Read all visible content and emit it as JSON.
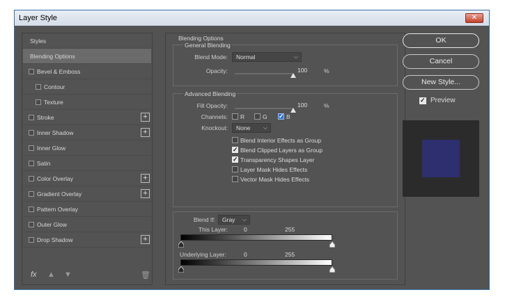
{
  "window": {
    "title": "Layer Style",
    "close_icon": "close-icon"
  },
  "styles_list": {
    "header": "Styles",
    "items": [
      {
        "label": "Blending Options",
        "checkbox": false,
        "selected": true,
        "plus": false,
        "indent": false
      },
      {
        "label": "Bevel & Emboss",
        "checkbox": true,
        "selected": false,
        "plus": false,
        "indent": false
      },
      {
        "label": "Contour",
        "checkbox": true,
        "selected": false,
        "plus": false,
        "indent": true
      },
      {
        "label": "Texture",
        "checkbox": true,
        "selected": false,
        "plus": false,
        "indent": true
      },
      {
        "label": "Stroke",
        "checkbox": true,
        "selected": false,
        "plus": true,
        "indent": false
      },
      {
        "label": "Inner Shadow",
        "checkbox": true,
        "selected": false,
        "plus": true,
        "indent": false
      },
      {
        "label": "Inner Glow",
        "checkbox": true,
        "selected": false,
        "plus": false,
        "indent": false
      },
      {
        "label": "Satin",
        "checkbox": true,
        "selected": false,
        "plus": false,
        "indent": false
      },
      {
        "label": "Color Overlay",
        "checkbox": true,
        "selected": false,
        "plus": true,
        "indent": false
      },
      {
        "label": "Gradient Overlay",
        "checkbox": true,
        "selected": false,
        "plus": true,
        "indent": false
      },
      {
        "label": "Pattern Overlay",
        "checkbox": true,
        "selected": false,
        "plus": false,
        "indent": false
      },
      {
        "label": "Outer Glow",
        "checkbox": true,
        "selected": false,
        "plus": false,
        "indent": false
      },
      {
        "label": "Drop Shadow",
        "checkbox": true,
        "selected": false,
        "plus": true,
        "indent": false
      }
    ],
    "bottom_icons": {
      "fx": "fx",
      "up": "▲",
      "down": "▼",
      "trash": "🗑"
    }
  },
  "blending": {
    "section_title": "Blending Options",
    "general": {
      "title": "General Blending",
      "blend_mode_label": "Blend Mode:",
      "blend_mode_value": "Normal",
      "opacity_label": "Opacity:",
      "opacity_value": "100",
      "opacity_unit": "%",
      "opacity_level": 1.0
    },
    "advanced": {
      "title": "Advanced Blending",
      "fill_opacity_label": "Fill Opacity:",
      "fill_opacity_value": "100",
      "fill_opacity_unit": "%",
      "fill_opacity_level": 1.0,
      "channels_label": "Channels:",
      "channel_r": "R",
      "channel_g": "G",
      "channel_b": "B",
      "channel_r_checked": false,
      "channel_g_checked": false,
      "channel_b_checked": true,
      "knockout_label": "Knockout:",
      "knockout_value": "None",
      "options": [
        {
          "label": "Blend Interior Effects as Group",
          "checked": false
        },
        {
          "label": "Blend Clipped Layers as Group",
          "checked": true
        },
        {
          "label": "Transparency Shapes Layer",
          "checked": true
        },
        {
          "label": "Layer Mask Hides Effects",
          "checked": false
        },
        {
          "label": "Vector Mask Hides Effects",
          "checked": false
        }
      ]
    },
    "blend_if": {
      "label": "Blend If:",
      "value": "Gray",
      "this_layer_label": "This Layer:",
      "this_layer_low": "0",
      "this_layer_high": "255",
      "underlying_label": "Underlying Layer:",
      "underlying_low": "0",
      "underlying_high": "255"
    }
  },
  "buttons": {
    "ok": "OK",
    "cancel": "Cancel",
    "new_style": "New Style..."
  },
  "preview": {
    "label": "Preview",
    "checked": true,
    "swatch_color": "#2d2f6e"
  }
}
